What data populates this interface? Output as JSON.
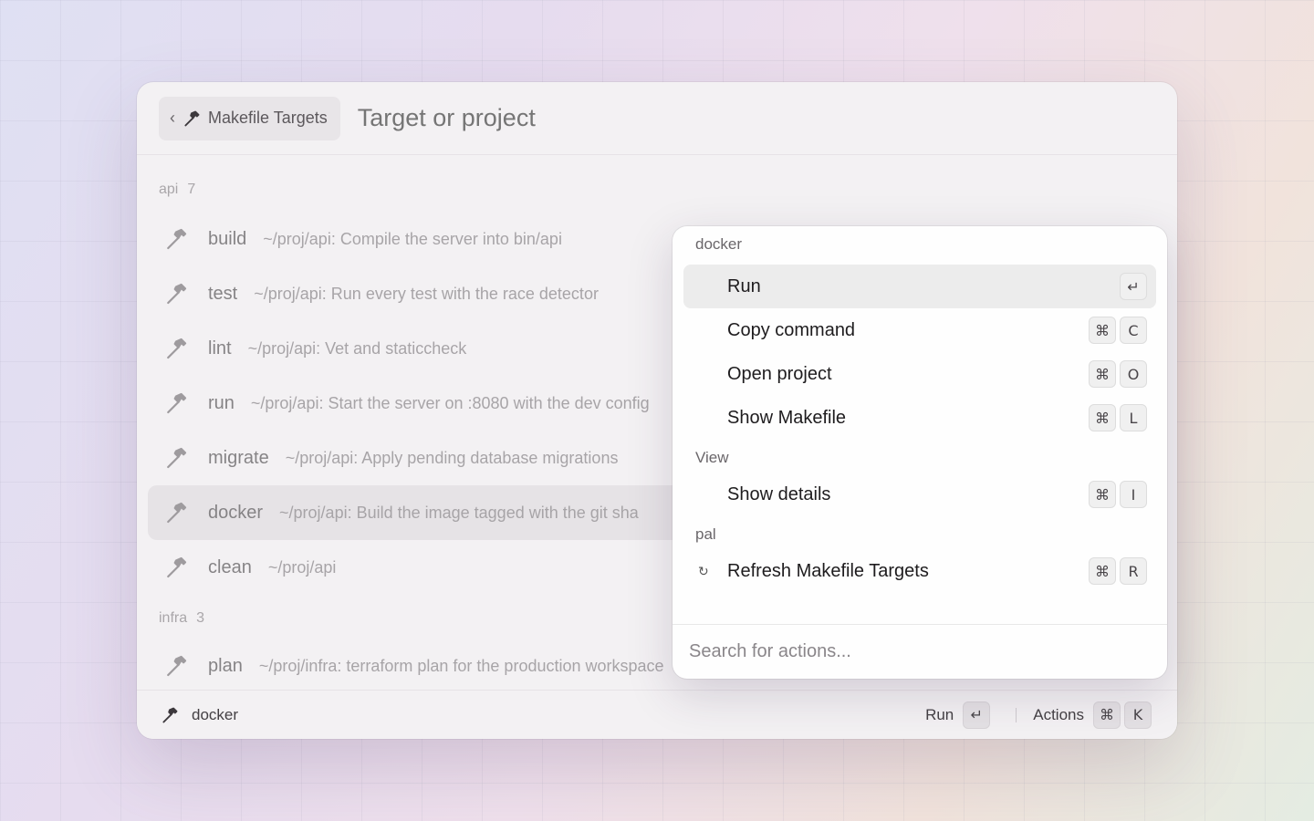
{
  "header": {
    "breadcrumb_label": "Makefile Targets",
    "search_placeholder": "Target or project"
  },
  "list": {
    "sections": [
      {
        "name": "api",
        "count": "7",
        "items": [
          {
            "name": "build",
            "desc": "~/proj/api: Compile the server into bin/api"
          },
          {
            "name": "test",
            "desc": "~/proj/api: Run every test with the race detector"
          },
          {
            "name": "lint",
            "desc": "~/proj/api: Vet and staticcheck"
          },
          {
            "name": "run",
            "desc": "~/proj/api: Start the server on :8080 with the dev config"
          },
          {
            "name": "migrate",
            "desc": "~/proj/api: Apply pending database migrations"
          },
          {
            "name": "docker",
            "desc": "~/proj/api: Build the image tagged with the git sha"
          },
          {
            "name": "clean",
            "desc": "~/proj/api"
          }
        ]
      },
      {
        "name": "infra",
        "count": "3",
        "items": [
          {
            "name": "plan",
            "desc": "~/proj/infra: terraform plan for the production workspace"
          }
        ]
      }
    ],
    "selected": "docker"
  },
  "actions_panel": {
    "sections": [
      {
        "title": "docker",
        "items": [
          {
            "label": "Run",
            "keys": [
              "↵"
            ]
          },
          {
            "label": "Copy command",
            "keys": [
              "⌘",
              "C"
            ]
          },
          {
            "label": "Open project",
            "keys": [
              "⌘",
              "O"
            ]
          },
          {
            "label": "Show Makefile",
            "keys": [
              "⌘",
              "L"
            ]
          }
        ]
      },
      {
        "title": "View",
        "items": [
          {
            "label": "Show details",
            "keys": [
              "⌘",
              "I"
            ]
          }
        ]
      },
      {
        "title": "pal",
        "items": [
          {
            "label": "Refresh Makefile Targets",
            "keys": [
              "⌘",
              "R"
            ],
            "icon": "↻"
          }
        ]
      }
    ],
    "search_placeholder": "Search for actions..."
  },
  "footer": {
    "selected_name": "docker",
    "primary_action": "Run",
    "primary_key": "↵",
    "actions_label": "Actions",
    "actions_keys": [
      "⌘",
      "K"
    ]
  }
}
